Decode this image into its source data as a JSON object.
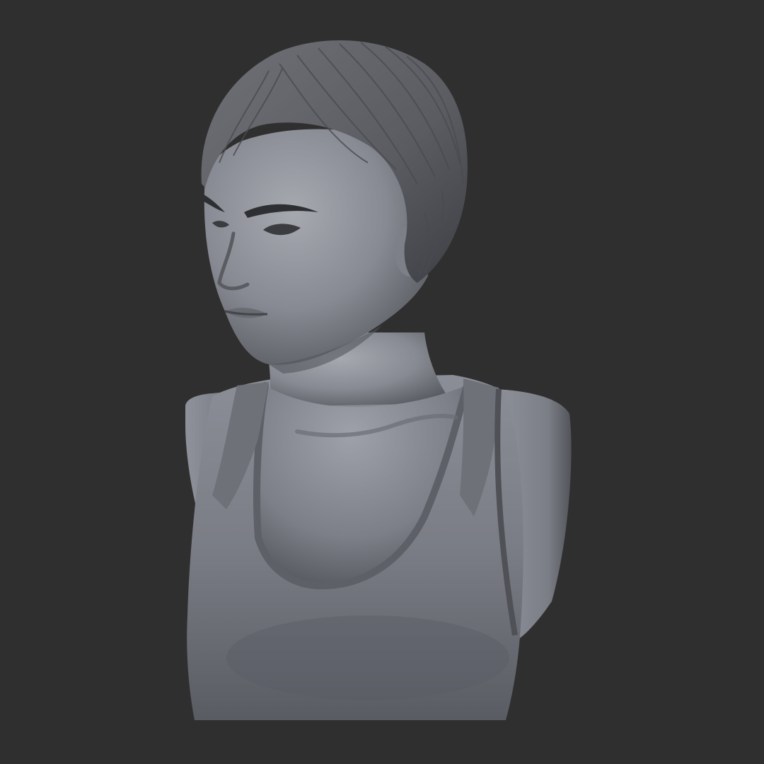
{
  "scene": {
    "background_color": "#2f2f2f",
    "subject": "sculpted-bust",
    "material_colors": {
      "skin_light": "#9ea1a8",
      "skin_mid": "#7f828a",
      "skin_shadow": "#54565c",
      "hair_light": "#6d6f75",
      "hair_dark": "#47484d",
      "cloth_light": "#7a7d85",
      "cloth_shadow": "#505258",
      "brow_color": "#2e2f33"
    }
  }
}
